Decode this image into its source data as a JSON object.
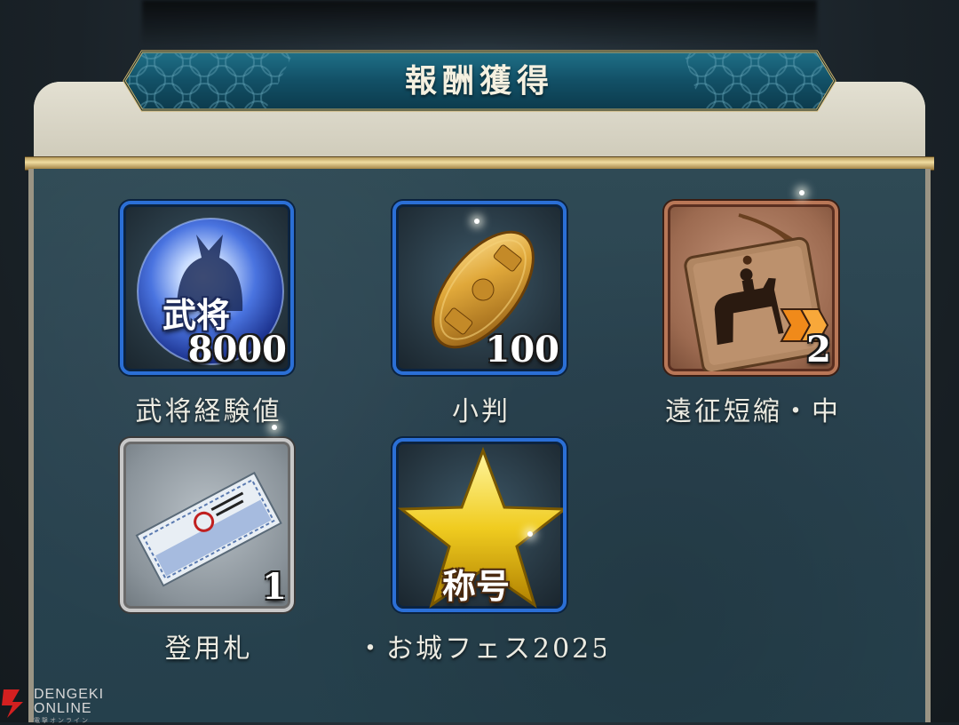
{
  "dialog": {
    "title": "報酬獲得"
  },
  "items": [
    {
      "name": "武将経験値",
      "count": "8000",
      "overlay": "武将",
      "icon": "warrior-exp-orb-icon",
      "frame": "blue"
    },
    {
      "name": "小判",
      "count": "100",
      "overlay": "",
      "icon": "koban-gold-coin-icon",
      "frame": "blue"
    },
    {
      "name": "遠征短縮・中",
      "count": "2",
      "overlay": "",
      "icon": "expedition-tag-horse-icon",
      "frame": "copper"
    },
    {
      "name": "登用札",
      "count": "1",
      "overlay": "",
      "icon": "recruit-ticket-icon",
      "frame": "silver"
    },
    {
      "name": "・お城フェス2025",
      "count": "",
      "overlay": "称号",
      "icon": "title-star-icon",
      "frame": "blue"
    }
  ],
  "watermark": {
    "line1": "DENGEKI",
    "line2": "ONLINE",
    "line3": "電撃オンライン"
  },
  "colors": {
    "banner": "#15566b",
    "panel": "#2a4350",
    "gold": "#d4b46a"
  }
}
